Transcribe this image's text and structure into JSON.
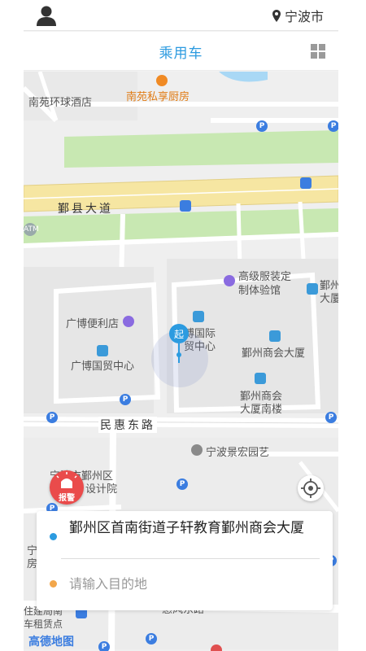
{
  "header": {
    "city": "宁波市",
    "title": "乘用车"
  },
  "map": {
    "labels": {
      "hotel": "南苑环球酒店",
      "restaurant": "南苑私享厨房",
      "main_road": "鄞县大道",
      "tailor": "高级服装定制体验馆",
      "tailor_line1": "高级服装定",
      "tailor_line2": "制体验馆",
      "convenience": "广博便利店",
      "guangbo_center": "广博国贸中心",
      "intl_line1": "博国际",
      "intl_line2": "贸中心",
      "chamber": "鄞州商会大厦",
      "chamber_south_line1": "鄞州商会",
      "chamber_south_line2": "大厦南楼",
      "yz_line1": "鄞州",
      "yz_line2": "大厦",
      "minhui_road": "民惠东路",
      "garden": "宁波景宏园艺",
      "design_line1": "宁波市鄞州区",
      "design_line2": "设计院",
      "bottom_road": "惠风东路",
      "bottom_left1": "宁",
      "bottom_left2": "房",
      "bottom_left3": "住建局南",
      "bottom_left4": "车租赁点",
      "atm": "ATM"
    },
    "start_marker": "起",
    "alarm_label": "报警",
    "logo": "高德地图",
    "parking_symbol": "P"
  },
  "trip": {
    "start_address": "鄞州区首南街道子轩教育鄞州商会大厦",
    "destination_placeholder": "请输入目的地"
  },
  "colors": {
    "accent": "#2c9be0",
    "alarm": "#ea4b4b",
    "destination_dot": "#f2a64a",
    "map_green": "#c8e8b2",
    "road_yellow": "#f6e6a2"
  }
}
